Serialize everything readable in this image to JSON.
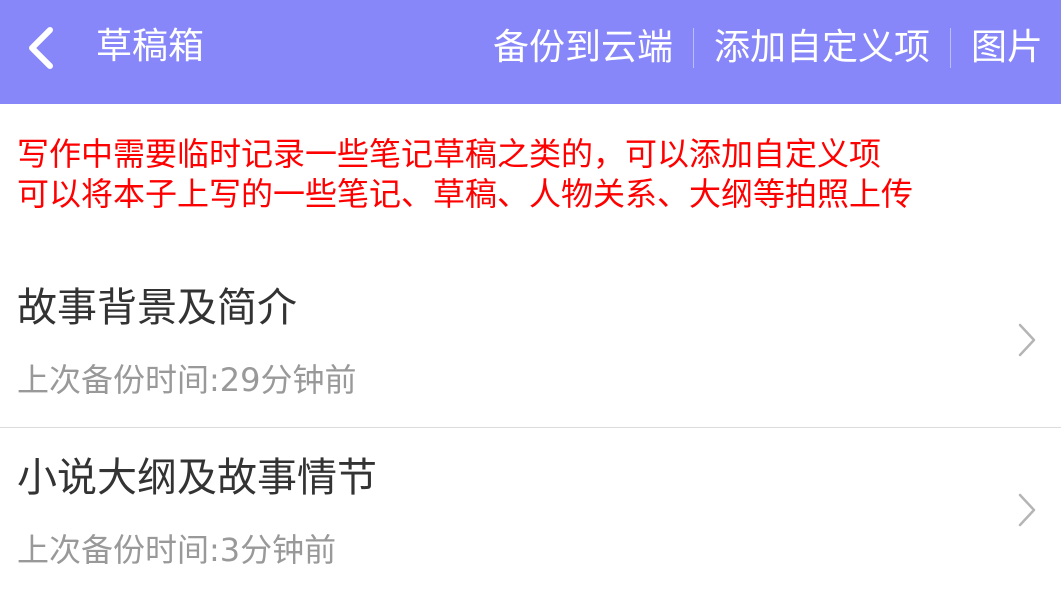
{
  "header": {
    "title": "草稿箱",
    "actions": [
      "备份到云端",
      "添加自定义项",
      "图片"
    ],
    "background_color": "#8787fa"
  },
  "notice": {
    "lines": [
      "写作中需要临时记录一些笔记草稿之类的，可以添加自定义项",
      "可以将本子上写的一些笔记、草稿、人物关系、大纲等拍照上传"
    ],
    "color": "#ff0000"
  },
  "items": [
    {
      "title": "故事背景及简介",
      "subtitle": "上次备份时间:29分钟前"
    },
    {
      "title": "小说大纲及故事情节",
      "subtitle": "上次备份时间:3分钟前"
    }
  ],
  "icons": {
    "back": "chevron-left-icon",
    "item_arrow": "chevron-right-icon"
  }
}
